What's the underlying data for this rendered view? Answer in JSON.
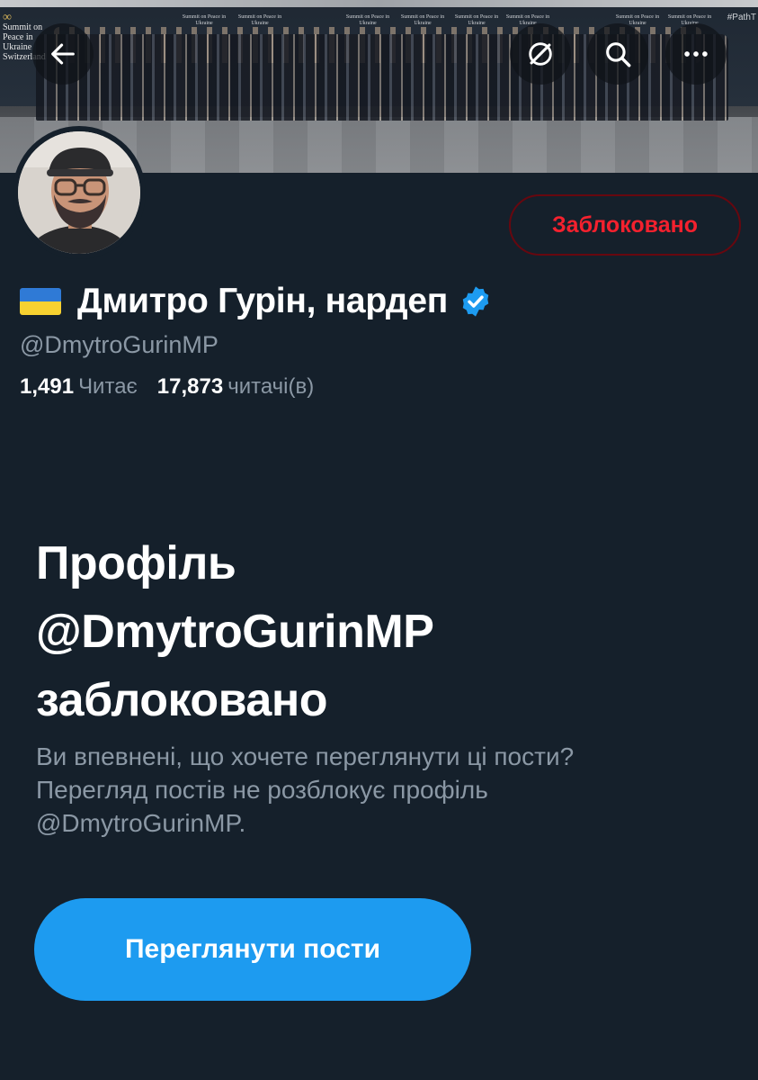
{
  "banner": {
    "logo_text": "Summit on Peace in Ukraine",
    "logo_sub": "Switzerland",
    "sign_text": "Summit on Peace in Ukraine",
    "hashtag": "#PathT"
  },
  "nav": {
    "back_icon": "arrow-left-icon",
    "grok_icon": "slash-circle-icon",
    "search_icon": "search-icon",
    "more_icon": "more-dots-icon"
  },
  "profile": {
    "display_name": "Дмитро Гурін, нардеп",
    "flag": "ukraine-flag",
    "verified": true,
    "handle": "@DmytroGurinMP",
    "following_count": "1,491",
    "following_label": "Читає",
    "followers_count": "17,873",
    "followers_label": "читачі(в)",
    "blocked_button_label": "Заблоковано"
  },
  "blocked": {
    "title_line1": "Профіль",
    "title_line2": "@DmytroGurinMP",
    "title_line3": "заблоковано",
    "desc_line1": "Ви впевнені, що хочете переглянути ці пости?",
    "desc_line2": "Перегляд постів не розблокує профіль",
    "desc_line3": "@DmytroGurinMP.",
    "view_button_label": "Переглянути пости"
  },
  "colors": {
    "background": "#15202b",
    "accent": "#1d9bf0",
    "danger": "#f4212e",
    "muted": "#8b98a5"
  }
}
